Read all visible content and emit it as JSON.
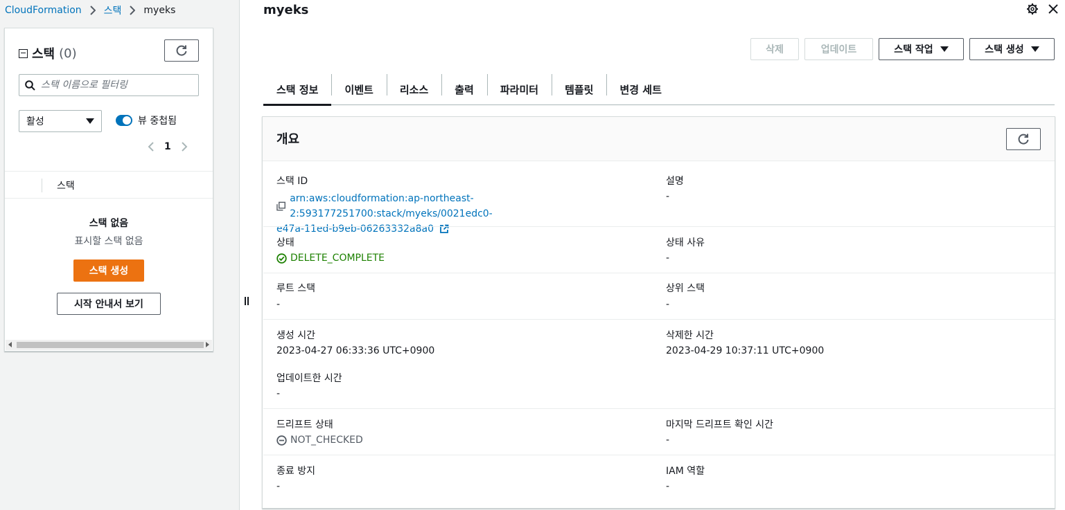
{
  "breadcrumb": {
    "items": [
      "CloudFormation",
      "스택",
      "myeks"
    ]
  },
  "left_panel": {
    "title": "스택",
    "count": "(0)",
    "search_placeholder": "스택 이름으로 필터링",
    "filter_select": "활성",
    "toggle_label": "뷰 중첩됨",
    "page_number": "1",
    "column_header": "스택",
    "empty_title": "스택 없음",
    "empty_subtitle": "표시할 스택 없음",
    "create_button": "스택 생성",
    "guide_button": "시작 안내서 보기"
  },
  "header": {
    "title": "myeks",
    "buttons": {
      "delete": "삭제",
      "update": "업데이트",
      "stack_actions": "스택 작업",
      "create_stack": "스택 생성"
    }
  },
  "tabs": [
    "스택 정보",
    "이벤트",
    "리소스",
    "출력",
    "파라미터",
    "템플릿",
    "변경 세트"
  ],
  "overview": {
    "title": "개요",
    "fields": {
      "stack_id_label": "스택 ID",
      "stack_id_line1": "arn:aws:cloudformation:ap-northeast-2:593177251700:stack/myeks/0021edc0-",
      "stack_id_line2": "e47a-11ed-b9eb-06263332a8a0",
      "description_label": "설명",
      "description_value": "-",
      "status_label": "상태",
      "status_value": "DELETE_COMPLETE",
      "status_reason_label": "상태 사유",
      "status_reason_value": "-",
      "root_stack_label": "루트 스택",
      "root_stack_value": "-",
      "parent_stack_label": "상위 스택",
      "parent_stack_value": "-",
      "created_time_label": "생성 시간",
      "created_time_value": "2023-04-27 06:33:36 UTC+0900",
      "deleted_time_label": "삭제한 시간",
      "deleted_time_value": "2023-04-29 10:37:11 UTC+0900",
      "updated_time_label": "업데이트한 시간",
      "updated_time_value": "-",
      "drift_status_label": "드리프트 상태",
      "drift_status_value": "NOT_CHECKED",
      "last_drift_label": "마지막 드리프트 확인 시간",
      "last_drift_value": "-",
      "termination_protection_label": "종료 방지",
      "termination_protection_value": "-",
      "iam_role_label": "IAM 역할",
      "iam_role_value": "-"
    }
  },
  "colors": {
    "link": "#0073bb",
    "primary": "#ec7211",
    "success": "#1d8102",
    "toggle": "#0073bb"
  },
  "icons": [
    "chevron-right-icon",
    "refresh-icon",
    "search-icon",
    "chevron-left-icon",
    "copy-icon",
    "external-link-icon",
    "status-success-icon",
    "status-not-checked-icon",
    "settings-icon",
    "close-icon",
    "caret-down-icon"
  ]
}
